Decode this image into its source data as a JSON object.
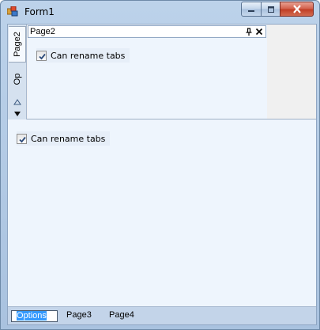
{
  "window": {
    "title": "Form1",
    "accent": "#3399ff"
  },
  "icons": {
    "app": "app-icon",
    "minimize": "minimize-icon",
    "maximize": "maximize-icon",
    "close": "close-icon",
    "pin": "pin-icon",
    "panel_close": "close-icon",
    "scroll_up": "triangle-up-icon",
    "scroll_down": "triangle-down-icon"
  },
  "side_tabs": [
    {
      "label": "Page2",
      "active": true
    },
    {
      "label": "Op",
      "active": false
    }
  ],
  "dock_panel": {
    "caption": "Page2",
    "checkbox": {
      "label": "Can rename tabs",
      "checked": true
    }
  },
  "main": {
    "checkbox": {
      "label": "Can rename tabs",
      "checked": true
    }
  },
  "bottom_tabs": [
    {
      "label": "Options",
      "selected": true
    },
    {
      "label": "Page3",
      "selected": false
    },
    {
      "label": "Page4",
      "selected": false
    }
  ]
}
